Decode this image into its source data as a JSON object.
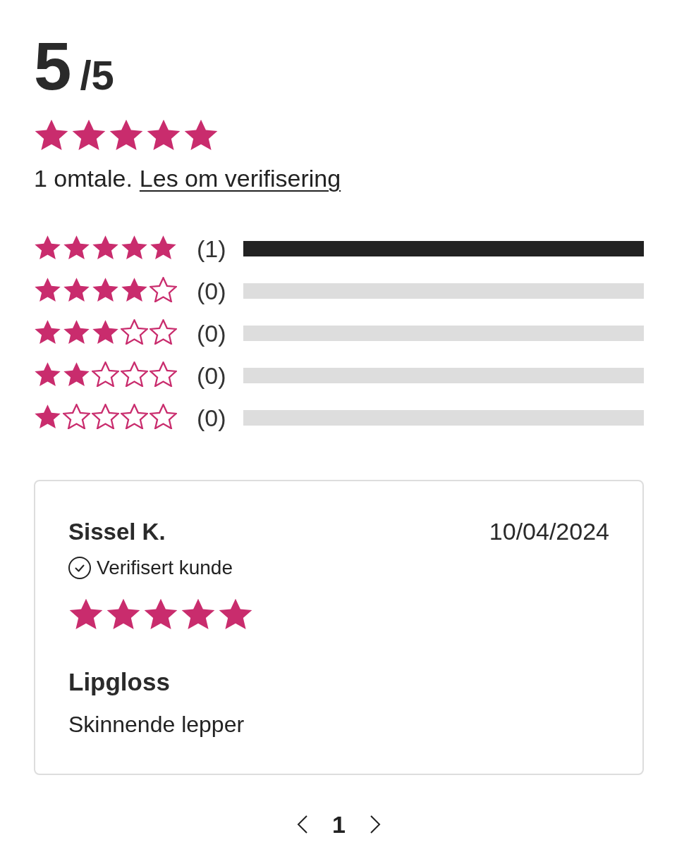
{
  "summary": {
    "score": "5",
    "out_of": "/5",
    "stars": 5,
    "count_text": "1 omtale.",
    "link": "Les om verifisering"
  },
  "distribution": [
    {
      "stars": 5,
      "count": "(1)",
      "level": 1
    },
    {
      "stars": 4,
      "count": "(0)",
      "level": 0
    },
    {
      "stars": 3,
      "count": "(0)",
      "level": 0
    },
    {
      "stars": 2,
      "count": "(0)",
      "level": 0
    },
    {
      "stars": 1,
      "count": "(0)",
      "level": 0
    }
  ],
  "reviews": [
    {
      "author": "Sissel K.",
      "date": "10/04/2024",
      "verified": true,
      "verified_label": "Verifisert kunde",
      "stars": 5,
      "title": "Lipgloss",
      "body": "Skinnende lepper"
    }
  ],
  "pagination": {
    "pages": [
      {
        "label": "1",
        "selected": true
      }
    ]
  }
}
